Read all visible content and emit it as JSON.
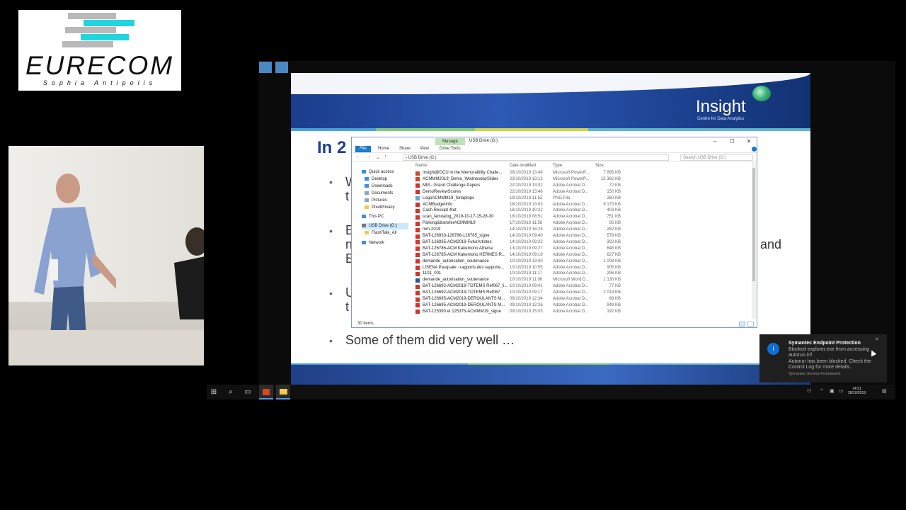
{
  "logo": {
    "name": "EURECOM",
    "tagline": "Sophia Antipolis"
  },
  "slide": {
    "brand": "Insight",
    "brand_sub": "Centre for Data Analytics",
    "title_fragment": "In 2",
    "bullet_fragments": [
      "W",
      "t",
      "E",
      "n",
      "E",
      "U",
      "t"
    ],
    "right_fragment": "and",
    "last_bullet": "Some of them did very well …"
  },
  "explorer": {
    "ribbon_context": "Manage",
    "title": "USB Drive (G:)",
    "tabs": [
      "File",
      "Home",
      "Share",
      "View",
      "Drive Tools"
    ],
    "window_buttons": [
      "–",
      "☐",
      "✕"
    ],
    "path": "› USB Drive (G:)",
    "search_placeholder": "Search USB Drive (G:)",
    "nav": [
      "Quick access",
      "Desktop",
      "Downloads",
      "Documents",
      "Pictures",
      "PixelPrivacy",
      "This PC",
      "USB Drive (G:)",
      "FlashTalk_All",
      "Network"
    ],
    "columns": [
      "Name",
      "Date modified",
      "Type",
      "Size"
    ],
    "files": [
      {
        "name": "Insight@DCU in the Memorability Challe...",
        "date": "28/10/2019 13:48",
        "type": "Microsoft PowerP...",
        "size": "7 895 KB",
        "icon": "ppt"
      },
      {
        "name": "ACMMM2019_Demo_WednesdaySlides",
        "date": "23/10/2019 13:12",
        "type": "Microsoft PowerP...",
        "size": "15 362 KB",
        "icon": "ppt"
      },
      {
        "name": "MM - Grand Challenge Papers",
        "date": "22/10/2019 13:02",
        "type": "Adobe Acrobat D...",
        "size": "72 KB",
        "icon": "pdf"
      },
      {
        "name": "DemoReviewScores",
        "date": "22/10/2019 13:46",
        "type": "Adobe Acrobat D...",
        "size": "150 KB",
        "icon": "pdf"
      },
      {
        "name": "LogoACMMM19_forlaptops",
        "date": "19/10/2019 11:52",
        "type": "PNG File",
        "size": "260 KB",
        "icon": "png"
      },
      {
        "name": "ACMBudgetInfo",
        "date": "18/10/2019 13:03",
        "type": "Adobe Acrobat D...",
        "size": "9 173 KB",
        "icon": "pdf"
      },
      {
        "name": "Cash Receipt 4tut",
        "date": "18/10/2019 10:22",
        "type": "Adobe Acrobat D...",
        "size": "403 KB",
        "icon": "pdf"
      },
      {
        "name": "scan_lamoalog_2019-10-17-15-28-30",
        "date": "18/10/2019 08:51",
        "type": "Adobe Acrobat D...",
        "size": "751 KB",
        "icon": "pdf"
      },
      {
        "name": "Parking&transferACMMM19",
        "date": "17/10/2019 11:56",
        "type": "Adobe Acrobat D...",
        "size": "85 KB",
        "icon": "pdf"
      },
      {
        "name": "mm-2019",
        "date": "14/10/2019 18:25",
        "type": "Adobe Acrobat D...",
        "size": "282 KB",
        "icon": "pdf"
      },
      {
        "name": "BAT-126933-126786-126785_signe",
        "date": "14/10/2019 09:40",
        "type": "Adobe Acrobat D...",
        "size": "579 KB",
        "icon": "pdf"
      },
      {
        "name": "BAT-126935-ACM2019-FuturArtistes",
        "date": "14/10/2019 09:22",
        "type": "Adobe Acrobat D...",
        "size": "392 KB",
        "icon": "pdf"
      },
      {
        "name": "BAT-126786-ACM Kakemono Athena",
        "date": "13/10/2019 09:27",
        "type": "Adobe Acrobat D...",
        "size": "648 KB",
        "icon": "pdf"
      },
      {
        "name": "BAT-126785-ACM Kakemono HERMES R...",
        "date": "14/10/2019 09:19",
        "type": "Adobe Acrobat D...",
        "size": "627 KB",
        "icon": "pdf"
      },
      {
        "name": "demande_autorisation_soutenance",
        "date": "10/10/2019 13:40",
        "type": "Adobe Acrobat D...",
        "size": "1 008 KB",
        "icon": "pdf"
      },
      {
        "name": "LISENA Pasquale - rapports des rapporte...",
        "date": "10/10/2019 10:55",
        "type": "Adobe Acrobat D...",
        "size": "905 KB",
        "icon": "pdf"
      },
      {
        "name": "1101_001",
        "date": "10/10/2019 11:17",
        "type": "Adobe Acrobat D...",
        "size": "296 KB",
        "icon": "pdf"
      },
      {
        "name": "demande_autorisation_soutenance",
        "date": "10/10/2019 11:06",
        "type": "Microsoft Word D...",
        "size": "1 130 KB",
        "icon": "doc"
      },
      {
        "name": "BAT-126692-ACM2019-TOTEMS Ref067_li...",
        "date": "10/10/2019 09:41",
        "type": "Adobe Acrobat D...",
        "size": "77 KB",
        "icon": "pdf"
      },
      {
        "name": "BAT-126692-ACM2019-TOTEMS Ref067",
        "date": "10/10/2019 09:17",
        "type": "Adobe Acrobat D...",
        "size": "2 019 KB",
        "icon": "pdf"
      },
      {
        "name": "BAT-126695-ACM2019-DEROULANTS M...",
        "date": "09/10/2019 12:34",
        "type": "Adobe Acrobat D...",
        "size": "68 KB",
        "icon": "pdf"
      },
      {
        "name": "BAT-126695-ACM2019-DEROULANTS M...",
        "date": "09/10/2019 12:26",
        "type": "Adobe Acrobat D...",
        "size": "949 KB",
        "icon": "pdf"
      },
      {
        "name": "BAT-125390 et 125375-ACMMM19_signe",
        "date": "09/10/2019 15:03",
        "type": "Adobe Acrobat D...",
        "size": "192 KB",
        "icon": "pdf"
      }
    ],
    "item_count": "30 items"
  },
  "taskbar": {
    "time": "14:51",
    "date": "28/10/2019"
  },
  "toast": {
    "title": "Symantec Endpoint Protection",
    "line1": "Blocked explorer.exe from accessing autorun.inf",
    "line2": "Autorun has been blocked.  Check the Control Log for more details.",
    "source": "Symantec Service Framework",
    "icon_glyph": "i"
  },
  "colors": {
    "accent": "#1979ca",
    "slide_blue": "#1c3f8f",
    "manage_green": "#bfe2b7"
  }
}
